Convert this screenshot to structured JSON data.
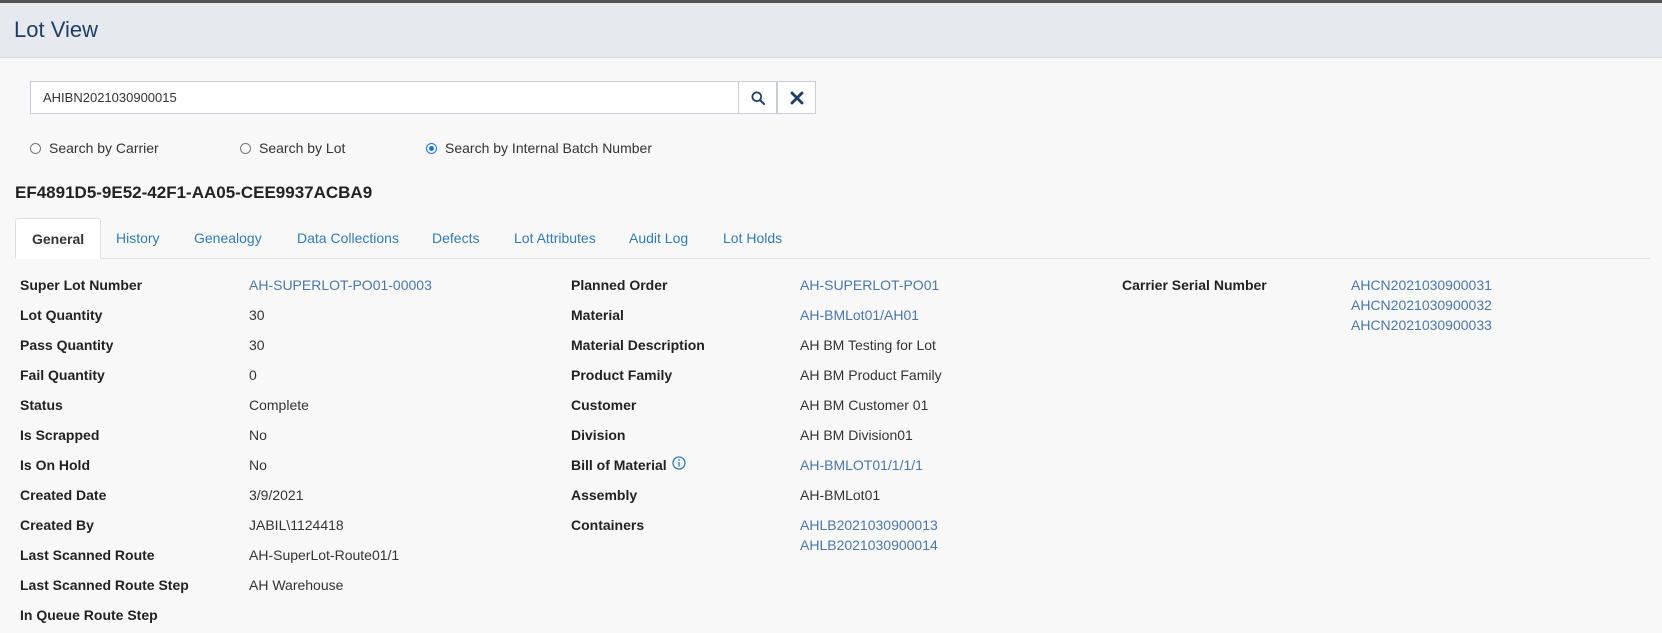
{
  "header": {
    "title": "Lot View"
  },
  "search": {
    "value": "AHIBN2021030900015",
    "icons": {
      "search": "search-icon",
      "clear": "close-icon"
    },
    "options": [
      {
        "label": "Search by Carrier",
        "checked": false
      },
      {
        "label": "Search by Lot",
        "checked": false
      },
      {
        "label": "Search by Internal Batch Number",
        "checked": true
      }
    ]
  },
  "lot": {
    "id": "EF4891D5-9E52-42F1-AA05-CEE9937ACBA9"
  },
  "tabs": [
    {
      "label": "General",
      "active": true
    },
    {
      "label": "History"
    },
    {
      "label": "Genealogy"
    },
    {
      "label": "Data Collections"
    },
    {
      "label": "Defects"
    },
    {
      "label": "Lot Attributes"
    },
    {
      "label": "Audit Log"
    },
    {
      "label": "Lot Holds"
    }
  ],
  "general": {
    "col1": [
      {
        "label": "Super Lot Number",
        "value": "AH-SUPERLOT-PO01-00003",
        "link": true
      },
      {
        "label": "Lot Quantity",
        "value": "30"
      },
      {
        "label": "Pass Quantity",
        "value": "30"
      },
      {
        "label": "Fail Quantity",
        "value": "0"
      },
      {
        "label": "Status",
        "value": "Complete"
      },
      {
        "label": "Is Scrapped",
        "value": "No"
      },
      {
        "label": "Is On Hold",
        "value": "No"
      },
      {
        "label": "Created Date",
        "value": "3/9/2021"
      },
      {
        "label": "Created By",
        "value": "JABIL\\1124418"
      },
      {
        "label": "Last Scanned Route",
        "value": "AH-SuperLot-Route01/1"
      },
      {
        "label": "Last Scanned Route Step",
        "value": "AH Warehouse"
      },
      {
        "label": "In Queue Route Step",
        "value": ""
      }
    ],
    "col2": [
      {
        "label": "Planned Order",
        "value": "AH-SUPERLOT-PO01",
        "link": true
      },
      {
        "label": "Material",
        "value": "AH-BMLot01/AH01",
        "link": true
      },
      {
        "label": "Material Description",
        "value": "AH BM Testing for Lot"
      },
      {
        "label": "Product Family",
        "value": "AH BM Product Family"
      },
      {
        "label": "Customer",
        "value": "AH BM Customer 01"
      },
      {
        "label": "Division",
        "value": "AH BM Division01"
      },
      {
        "label": "Bill of Material",
        "value": "AH-BMLOT01/1/1/1",
        "link": true,
        "icon": "info-icon"
      },
      {
        "label": "Assembly",
        "value": "AH-BMLot01"
      },
      {
        "label": "Containers",
        "values": [
          "AHLB2021030900013",
          "AHLB2021030900014"
        ],
        "link": true
      }
    ],
    "col3": [
      {
        "label": "Carrier Serial Number",
        "values": [
          "AHCN2021030900031",
          "AHCN2021030900032",
          "AHCN2021030900033"
        ],
        "link": true
      }
    ]
  },
  "colors": {
    "accent": "#337ab7",
    "link": "#4a76a8",
    "header_bg": "#e6e9ee",
    "title": "#1f3f66"
  }
}
